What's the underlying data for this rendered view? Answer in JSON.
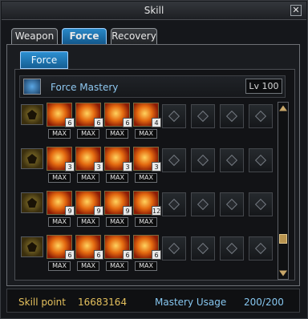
{
  "window": {
    "title": "Skill",
    "close_label": "✕"
  },
  "tabs": [
    {
      "label": "Weapon",
      "active": false
    },
    {
      "label": "Force",
      "active": true
    },
    {
      "label": "Recovery",
      "active": false
    }
  ],
  "subtab": {
    "label": "Force"
  },
  "mastery": {
    "label": "Force Mastery",
    "level": "Lv 100",
    "icon": "force-mastery-icon"
  },
  "rows": [
    {
      "icon": "row-icon-1",
      "skills": [
        {
          "count": "6",
          "max": "MAX"
        },
        {
          "count": "6",
          "max": "MAX"
        },
        {
          "count": "6",
          "max": "MAX"
        },
        {
          "count": "4",
          "max": "MAX"
        }
      ]
    },
    {
      "icon": "row-icon-2",
      "skills": [
        {
          "count": "3",
          "max": "MAX"
        },
        {
          "count": "3",
          "max": "MAX"
        },
        {
          "count": "3",
          "max": "MAX"
        },
        {
          "count": "3",
          "max": "MAX"
        }
      ]
    },
    {
      "icon": "row-icon-3",
      "skills": [
        {
          "count": "9",
          "max": "MAX"
        },
        {
          "count": "9",
          "max": "MAX"
        },
        {
          "count": "9",
          "max": "MAX"
        },
        {
          "count": "12",
          "max": "MAX"
        }
      ]
    },
    {
      "icon": "row-icon-4",
      "skills": [
        {
          "count": "6",
          "max": "MAX"
        },
        {
          "count": "6",
          "max": "MAX"
        },
        {
          "count": "6",
          "max": "MAX"
        },
        {
          "count": "6",
          "max": "MAX"
        }
      ]
    }
  ],
  "footer": {
    "skill_point_label": "Skill point",
    "skill_point_value": "16683164",
    "mastery_usage_label": "Mastery Usage",
    "mastery_usage_value": "200/200"
  }
}
